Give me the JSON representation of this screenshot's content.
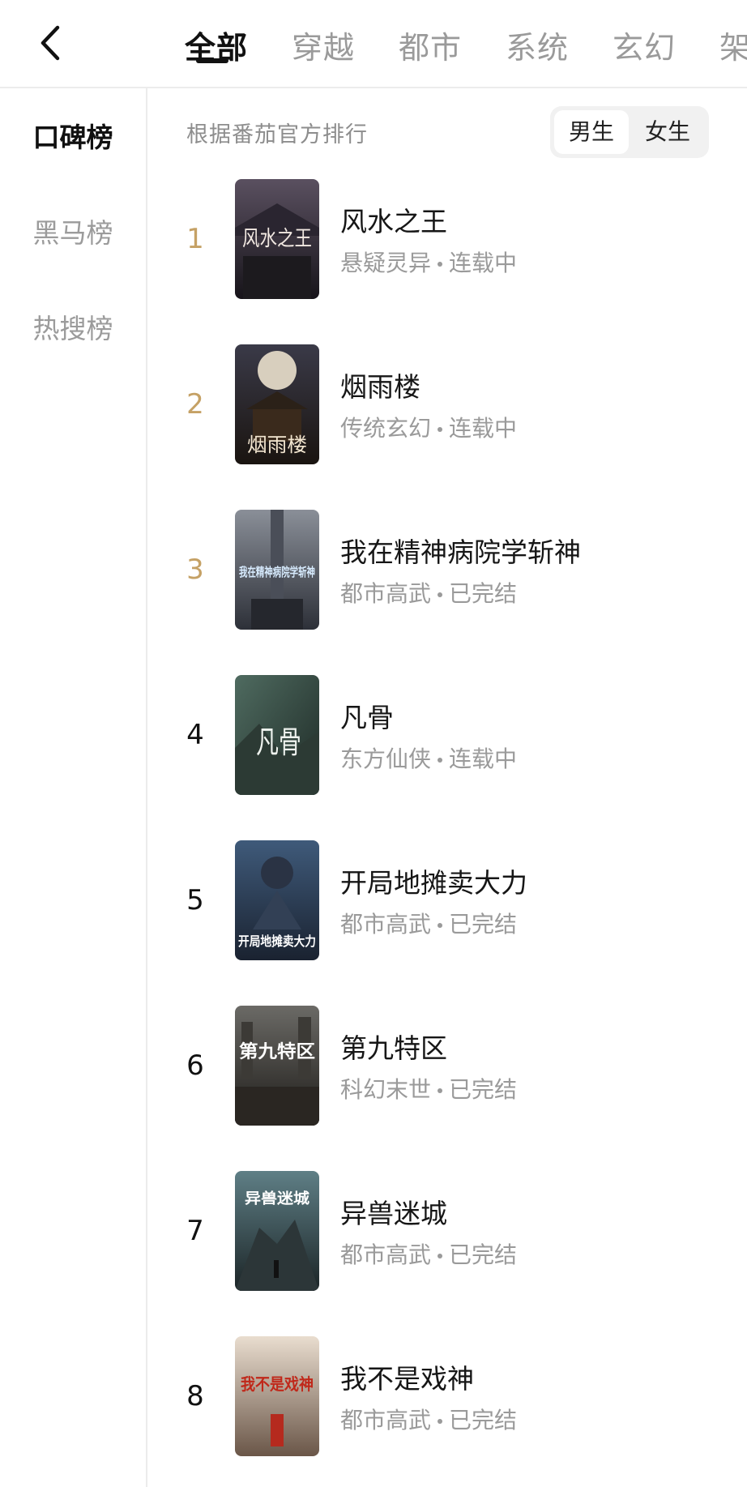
{
  "header": {
    "tabs": [
      {
        "label": "全部",
        "active": true
      },
      {
        "label": "穿越",
        "active": false
      },
      {
        "label": "都市",
        "active": false
      },
      {
        "label": "系统",
        "active": false
      },
      {
        "label": "玄幻",
        "active": false
      },
      {
        "label": "架",
        "active": false
      }
    ]
  },
  "sidebar": {
    "items": [
      {
        "label": "口碑榜",
        "active": true
      },
      {
        "label": "黑马榜",
        "active": false
      },
      {
        "label": "热搜榜",
        "active": false
      }
    ]
  },
  "main": {
    "note": "根据番茄官方排行",
    "gender": {
      "male": "男生",
      "female": "女生",
      "selected": "男生"
    },
    "books": [
      {
        "rank": "1",
        "title": "风水之王",
        "genre": "悬疑灵异",
        "status": "连载中",
        "cover_text": "风水之王"
      },
      {
        "rank": "2",
        "title": "烟雨楼",
        "genre": "传统玄幻",
        "status": "连载中",
        "cover_text": "烟雨楼"
      },
      {
        "rank": "3",
        "title": "我在精神病院学斩神",
        "genre": "都市高武",
        "status": "已完结",
        "cover_text": "我在精神病院学斩神"
      },
      {
        "rank": "4",
        "title": "凡骨",
        "genre": "东方仙侠",
        "status": "连载中",
        "cover_text": "凡骨"
      },
      {
        "rank": "5",
        "title": "开局地摊卖大力",
        "genre": "都市高武",
        "status": "已完结",
        "cover_text": "开局地摊卖大力"
      },
      {
        "rank": "6",
        "title": "第九特区",
        "genre": "科幻末世",
        "status": "已完结",
        "cover_text": "第九特区"
      },
      {
        "rank": "7",
        "title": "异兽迷城",
        "genre": "都市高武",
        "status": "已完结",
        "cover_text": "异兽迷城"
      },
      {
        "rank": "8",
        "title": "我不是戏神",
        "genre": "都市高武",
        "status": "已完结",
        "cover_text": "我不是戏神"
      }
    ]
  },
  "colors": {
    "rank_top3": "#c5a165",
    "text_primary": "#161616",
    "text_secondary": "#9a9a9a",
    "divider": "#ececec"
  },
  "icons": {
    "back": "chevron-left-icon"
  }
}
